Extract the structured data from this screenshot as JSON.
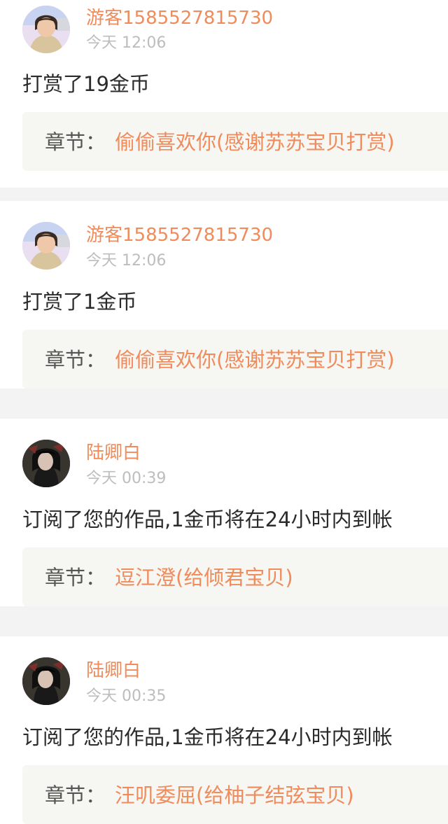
{
  "feed": {
    "items": [
      {
        "username": "游客1585527815730",
        "time": "今天 12:06",
        "message": "打赏了19金币",
        "chapter_label": "章节：",
        "chapter_title": "偷偷喜欢你(感谢苏苏宝贝打赏)",
        "avatar": "woman-photo"
      },
      {
        "username": "游客1585527815730",
        "time": "今天 12:06",
        "message": "打赏了1金币",
        "chapter_label": "章节：",
        "chapter_title": "偷偷喜欢你(感谢苏苏宝贝打赏)",
        "avatar": "woman-photo"
      },
      {
        "username": "陆卿白",
        "time": "今天 00:39",
        "message": "订阅了您的作品,1金币将在24小时内到帐",
        "chapter_label": "章节：",
        "chapter_title": "逗江澄(给倾君宝贝)",
        "avatar": "anime-photo"
      },
      {
        "username": "陆卿白",
        "time": "今天 00:35",
        "message": "订阅了您的作品,1金币将在24小时内到帐",
        "chapter_label": "章节：",
        "chapter_title": "汪叽委屈(给柚子结弦宝贝)",
        "avatar": "anime-photo"
      }
    ]
  },
  "colors": {
    "accent": "#f08b5b",
    "text": "#2b2b2b",
    "muted": "#bdbdbd",
    "chapter_bg": "#f6f6f3",
    "page_bg": "#f3f3f3"
  }
}
